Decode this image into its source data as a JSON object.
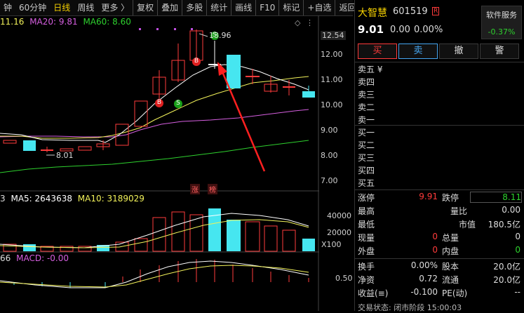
{
  "toolbar": {
    "left_clip": "钟",
    "items": [
      "60分钟",
      "日线",
      "周线",
      "更多 〉",
      "复权",
      "叠加",
      "多股",
      "统计",
      "画线",
      "F10",
      "标记",
      "+自选",
      "返回"
    ],
    "active_index": 1
  },
  "main": {
    "ma_legend": {
      "ma10": "11.16",
      "ma20": "MA20: 9.81",
      "ma60": "MA60: 8.60"
    },
    "y_ticks": [
      "12.54",
      "12.00",
      "11.00",
      "10.00",
      "9.00",
      "8.00",
      "7.00"
    ],
    "annotations": {
      "high": "13.96",
      "low": "8.01",
      "zhang": "涨",
      "bang": "榜"
    },
    "markers": {
      "s": "S",
      "b": "B"
    },
    "colors": {
      "up": "#ff3b3b",
      "down": "#46e6f0",
      "ma5": "#ffffff",
      "ma10": "#f2f25a",
      "ma20": "#d65fe0",
      "ma60": "#2ed12e",
      "arrow": "#ff2020"
    }
  },
  "volume": {
    "legend": {
      "clip": "3",
      "ma5": "MA5: 2643638",
      "ma10": "MA10: 3189029"
    },
    "y_ticks": [
      "40000",
      "20000",
      "X100"
    ]
  },
  "macd": {
    "legend": {
      "clip": "66",
      "macd": "MACD: -0.00"
    },
    "y_ticks": [
      "0.50"
    ]
  },
  "stock": {
    "name": "大智慧",
    "code": "601519",
    "badge": "R",
    "price": "9.01",
    "change": "0.00",
    "change_pct": "0.00%",
    "service_label": "软件服务",
    "service_pct": "-0.37%"
  },
  "buttons": {
    "buy": "买",
    "sell": "卖",
    "cancel": "撤",
    "alert": "警"
  },
  "order_book": {
    "sell": [
      "卖五 ¥",
      "卖四",
      "卖三",
      "卖二",
      "卖一"
    ],
    "buy": [
      "买一",
      "买二",
      "买三",
      "买四",
      "买五"
    ]
  },
  "stats": {
    "limit_up_label": "涨停",
    "limit_up": "9.91",
    "limit_down_label": "跌停",
    "limit_down": "8.11",
    "high_label": "最高",
    "ratio_label": "量比",
    "ratio": "0.00",
    "low_label": "最低",
    "mktcap_label": "市值",
    "mktcap": "180.5亿",
    "cur_vol_label": "现量",
    "cur_vol": "0",
    "total_vol_label": "总量",
    "total_vol": "0",
    "outer_label": "外盘",
    "outer": "0",
    "inner_label": "内盘",
    "inner": "0",
    "turnover_label": "换手",
    "turnover": "0.00%",
    "equity_label": "股本",
    "equity": "20.0亿",
    "nav_label": "净资",
    "nav": "0.72",
    "float_label": "流通",
    "float_val": "20.0亿",
    "eps_label": "收益(≡)",
    "eps": "-0.100",
    "pe_label": "PE(动)",
    "pe": "--"
  },
  "status": "交易状态: 闭市阶段 15:00:03"
}
